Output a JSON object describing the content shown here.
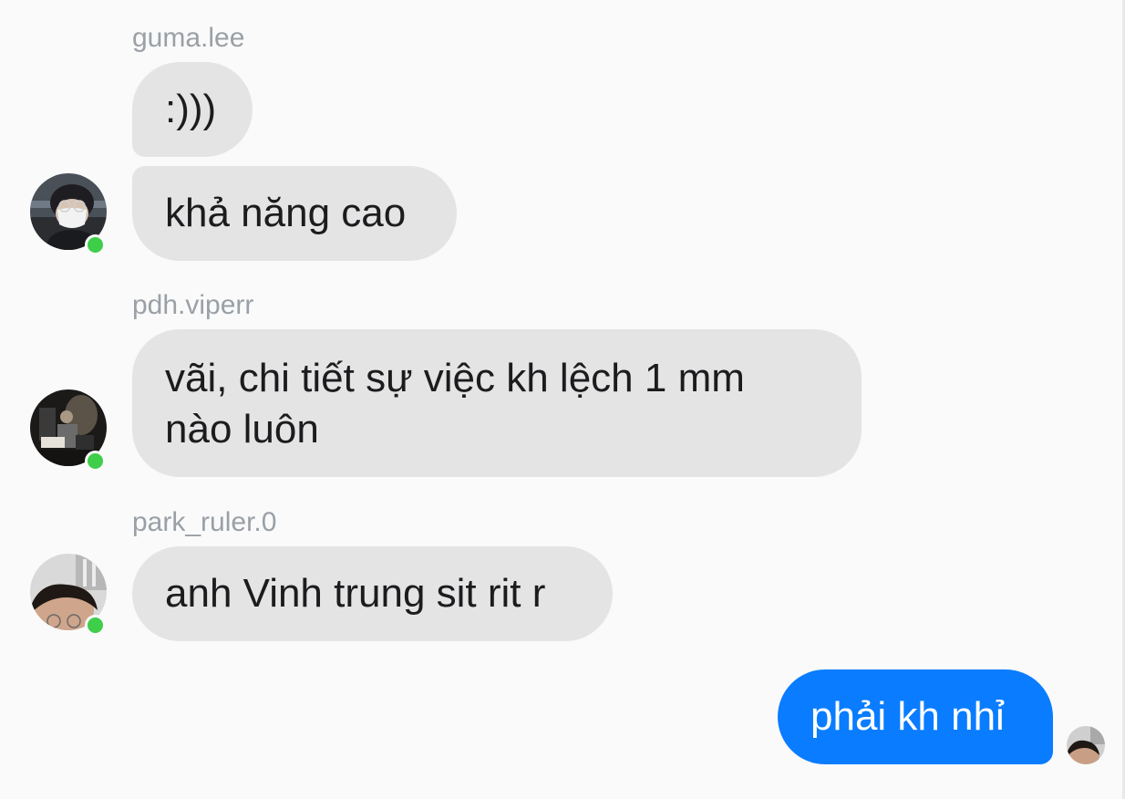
{
  "messages": [
    {
      "sender": "guma.lee",
      "bubbles": [
        ":)))",
        "khả năng cao"
      ],
      "online": true
    },
    {
      "sender": "pdh.viperr",
      "bubbles": [
        "vãi, chi tiết sự việc kh lệch 1 mm nào luôn"
      ],
      "online": true
    },
    {
      "sender": "park_ruler.0",
      "bubbles": [
        "anh Vinh trung sit rit r"
      ],
      "online": true
    },
    {
      "sender": "me",
      "bubbles": [
        "phải kh nhỉ"
      ],
      "outgoing": true
    }
  ],
  "lines": {
    "pdh_line1": "vãi, chi tiết sự việc kh lệch 1 mm",
    "pdh_line2": "nào luôn"
  },
  "colors": {
    "background": "#fafafa",
    "incoming_bubble": "#e4e4e5",
    "outgoing_bubble": "#0a7cff",
    "online_indicator": "#3fce4a",
    "sender_name": "#9aa0a6"
  }
}
